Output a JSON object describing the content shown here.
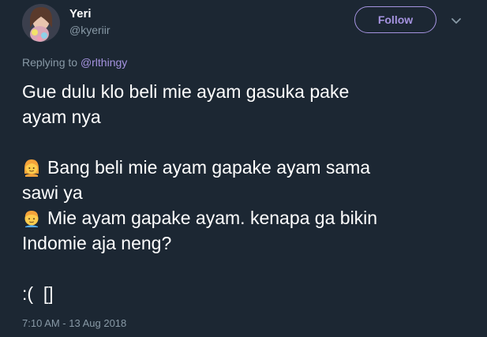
{
  "user": {
    "display_name": "Yeri",
    "handle": "@kyeriir"
  },
  "header": {
    "follow_label": "Follow"
  },
  "reply": {
    "prefix": "Replying to ",
    "mention": "@rlthingy"
  },
  "tweet": {
    "line1": "Gue dulu klo beli mie ayam gasuka pake",
    "line2": "ayam nya",
    "line3": "Bang beli mie ayam gapake ayam sama",
    "line4": "sawi ya",
    "line5": "Mie ayam gapake ayam. kenapa ga bikin",
    "line6": "Indomie aja neng?",
    "line7": ":(  []",
    "emoji1": "girl-emoji",
    "emoji2": "man-emoji"
  },
  "timestamp": "7:10 AM - 13 Aug 2018",
  "colors": {
    "background": "#1c2733",
    "accent": "#a593e0",
    "muted": "#8899a6",
    "text": "#ffffff"
  }
}
